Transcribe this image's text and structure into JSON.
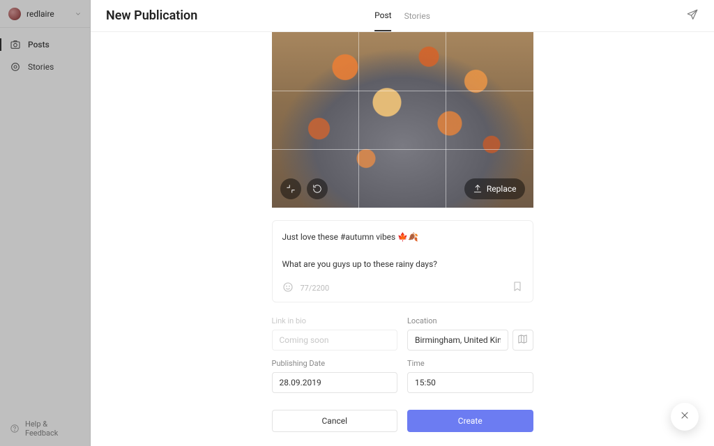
{
  "account": {
    "username": "redlaire"
  },
  "sidebar": {
    "items": [
      {
        "label": "Posts"
      },
      {
        "label": "Stories"
      }
    ],
    "help_label": "Help & Feedback"
  },
  "modal": {
    "title": "New Publication",
    "tabs": [
      {
        "label": "Post",
        "active": true
      },
      {
        "label": "Stories",
        "active": false
      }
    ],
    "image_controls": {
      "replace_label": "Replace"
    },
    "caption": {
      "text": "Just love these #autumn vibes 🍁🍂\n\nWhat are you guys up to these rainy days?",
      "counter": "77/2200"
    },
    "fields": {
      "link_in_bio": {
        "label": "Link in bio",
        "placeholder": "Coming soon"
      },
      "location": {
        "label": "Location",
        "value": "Birmingham, United Kingdom"
      },
      "publishing_date": {
        "label": "Publishing Date",
        "value": "28.09.2019"
      },
      "time": {
        "label": "Time",
        "value": "15:50"
      }
    },
    "actions": {
      "cancel": "Cancel",
      "create": "Create"
    }
  }
}
